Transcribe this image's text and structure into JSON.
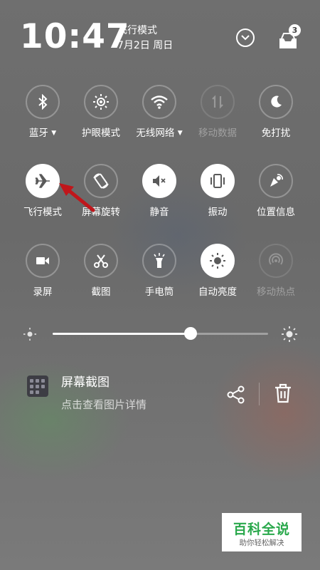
{
  "status": {
    "time": "10:47",
    "mode_text": "飞行模式",
    "date_text": "7月2日 周日",
    "notification_count": "3"
  },
  "quick_settings": [
    {
      "label": "蓝牙",
      "icon": "bluetooth-icon",
      "state": "off",
      "has_dropdown": true
    },
    {
      "label": "护眼模式",
      "icon": "eye-comfort-icon",
      "state": "off"
    },
    {
      "label": "无线网络",
      "icon": "wifi-icon",
      "state": "off",
      "has_dropdown": true
    },
    {
      "label": "移动数据",
      "icon": "mobile-data-icon",
      "state": "disabled"
    },
    {
      "label": "免打扰",
      "icon": "moon-icon",
      "state": "off"
    },
    {
      "label": "飞行模式",
      "icon": "airplane-icon",
      "state": "on"
    },
    {
      "label": "屏幕旋转",
      "icon": "screen-rotation-icon",
      "state": "off"
    },
    {
      "label": "静音",
      "icon": "mute-icon",
      "state": "on"
    },
    {
      "label": "振动",
      "icon": "vibrate-icon",
      "state": "on"
    },
    {
      "label": "位置信息",
      "icon": "location-icon",
      "state": "off"
    },
    {
      "label": "录屏",
      "icon": "screen-record-icon",
      "state": "off"
    },
    {
      "label": "截图",
      "icon": "scissors-icon",
      "state": "off"
    },
    {
      "label": "手电筒",
      "icon": "flashlight-icon",
      "state": "off"
    },
    {
      "label": "自动亮度",
      "icon": "auto-brightness-icon",
      "state": "on"
    },
    {
      "label": "移动热点",
      "icon": "hotspot-icon",
      "state": "disabled"
    }
  ],
  "brightness": {
    "level": 0.64
  },
  "notification": {
    "title": "屏幕截图",
    "subtitle": "点击查看图片详情"
  },
  "watermark": {
    "title": "百科全说",
    "subtitle": "助你轻松解决"
  },
  "colors": {
    "accent_arrow": "#c0161b",
    "watermark_green": "#29a84b"
  }
}
